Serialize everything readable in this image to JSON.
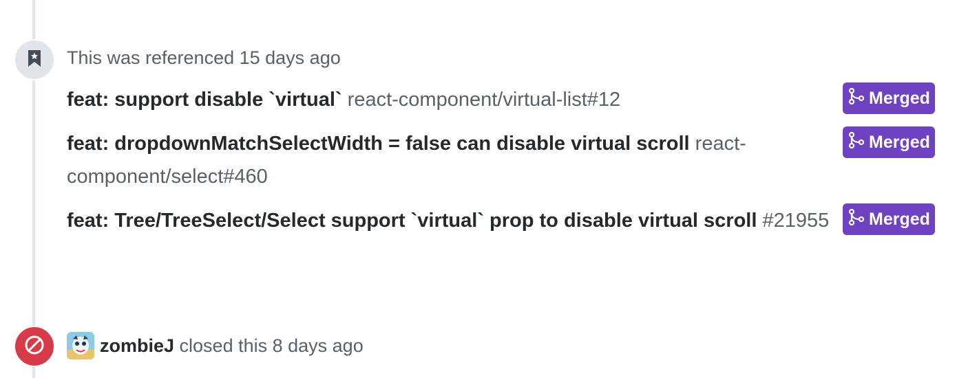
{
  "timeline": {
    "reference_event": {
      "header": "This was referenced 15 days ago",
      "icon": "bookmark-icon",
      "items": [
        {
          "title": "feat: support disable `virtual`",
          "ref": "react-component/virtual-list#12",
          "status": "Merged"
        },
        {
          "title": "feat: dropdownMatchSelectWidth = false can disable virtual scroll",
          "ref": "react-component/select#460",
          "status": "Merged"
        },
        {
          "title": "feat: Tree/TreeSelect/Select support `virtual` prop to disable virtual scroll",
          "ref": "#21955",
          "status": "Merged"
        }
      ]
    },
    "closed_event": {
      "author": "zombieJ",
      "action": "closed this 8 days ago",
      "icon": "circle-slash-icon"
    }
  },
  "colors": {
    "merged": "#6f42c1",
    "closed": "#d73a49",
    "timeline": "#e1e4e8",
    "muted_text": "#586069",
    "text": "#24292e"
  }
}
